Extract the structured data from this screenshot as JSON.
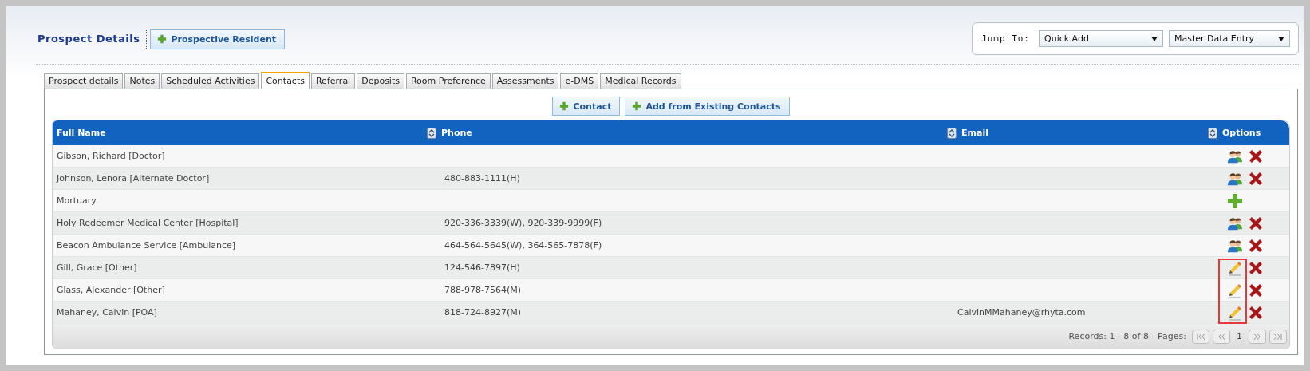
{
  "header": {
    "title": "Prospect Details",
    "add_button": "Prospective Resident"
  },
  "jump_to": {
    "label": "Jump To:",
    "selects": [
      "Quick Add",
      "Master Data Entry"
    ]
  },
  "tabs": [
    {
      "label": "Prospect details",
      "selected": false
    },
    {
      "label": "Notes",
      "selected": false
    },
    {
      "label": "Scheduled Activities",
      "selected": false
    },
    {
      "label": "Contacts",
      "selected": true
    },
    {
      "label": "Referral",
      "selected": false
    },
    {
      "label": "Deposits",
      "selected": false
    },
    {
      "label": "Room Preference",
      "selected": false
    },
    {
      "label": "Assessments",
      "selected": false
    },
    {
      "label": "e-DMS",
      "selected": false
    },
    {
      "label": "Medical Records",
      "selected": false
    }
  ],
  "actions": [
    "Contact",
    "Add from Existing Contacts"
  ],
  "table": {
    "columns": [
      "Full Name",
      "Phone",
      "Email",
      "Options"
    ],
    "rows": [
      {
        "name": "Gibson, Richard [Doctor]",
        "options": [
          {
            "kind": "people"
          },
          {
            "kind": "delete"
          }
        ],
        "marked": false
      },
      {
        "name": "Johnson, Lenora [Alternate Doctor]",
        "phone": "480-883-1111(H)",
        "options": [
          {
            "kind": "people"
          },
          {
            "kind": "delete"
          }
        ],
        "marked": false
      },
      {
        "name": "Mortuary",
        "options": [
          {
            "kind": "add"
          }
        ],
        "marked": false
      },
      {
        "name": "Holy Redeemer Medical Center [Hospital]",
        "phone": "920-336-3339(W), 920-339-9999(F)",
        "options": [
          {
            "kind": "people"
          },
          {
            "kind": "delete"
          }
        ],
        "marked": false
      },
      {
        "name": "Beacon Ambulance Service [Ambulance]",
        "phone": "464-564-5645(W), 364-565-7878(F)",
        "options": [
          {
            "kind": "people"
          },
          {
            "kind": "delete"
          }
        ],
        "marked": false
      },
      {
        "name": "Gill, Grace [Other]",
        "phone": "124-546-7897(H)",
        "options": [
          {
            "kind": "edit"
          },
          {
            "kind": "delete"
          }
        ],
        "marked": true
      },
      {
        "name": "Glass, Alexander [Other]",
        "phone": "788-978-7564(M)",
        "options": [
          {
            "kind": "edit"
          },
          {
            "kind": "delete"
          }
        ],
        "marked": true
      },
      {
        "name": "Mahaney, Calvin [POA]",
        "phone": "818-724-8927(M)",
        "email": "CalvinMMahaney@rhyta.com",
        "options": [
          {
            "kind": "edit"
          },
          {
            "kind": "delete"
          }
        ],
        "marked": true
      }
    ]
  },
  "pager": {
    "records": "Records: 1 - 8 of 8 - Pages:",
    "page": "1"
  }
}
